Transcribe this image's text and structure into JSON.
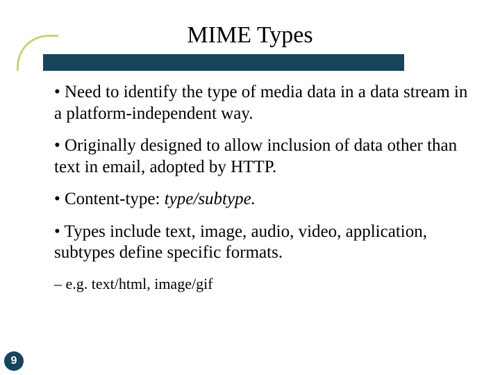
{
  "slide": {
    "title": "MIME Types",
    "bullet1": "• Need to identify the type of media data in a data stream in a platform-independent way.",
    "bullet2": "• Originally designed to allow inclusion of data other than text in email, adopted by HTTP.",
    "bullet3_prefix": "• Content-type: ",
    "bullet3_italic": "type/subtype.",
    "bullet4": "• Types include text, image, audio, video, application, subtypes define specific formats.",
    "sub1": "– e.g. text/html, image/gif",
    "page_number": "9"
  }
}
